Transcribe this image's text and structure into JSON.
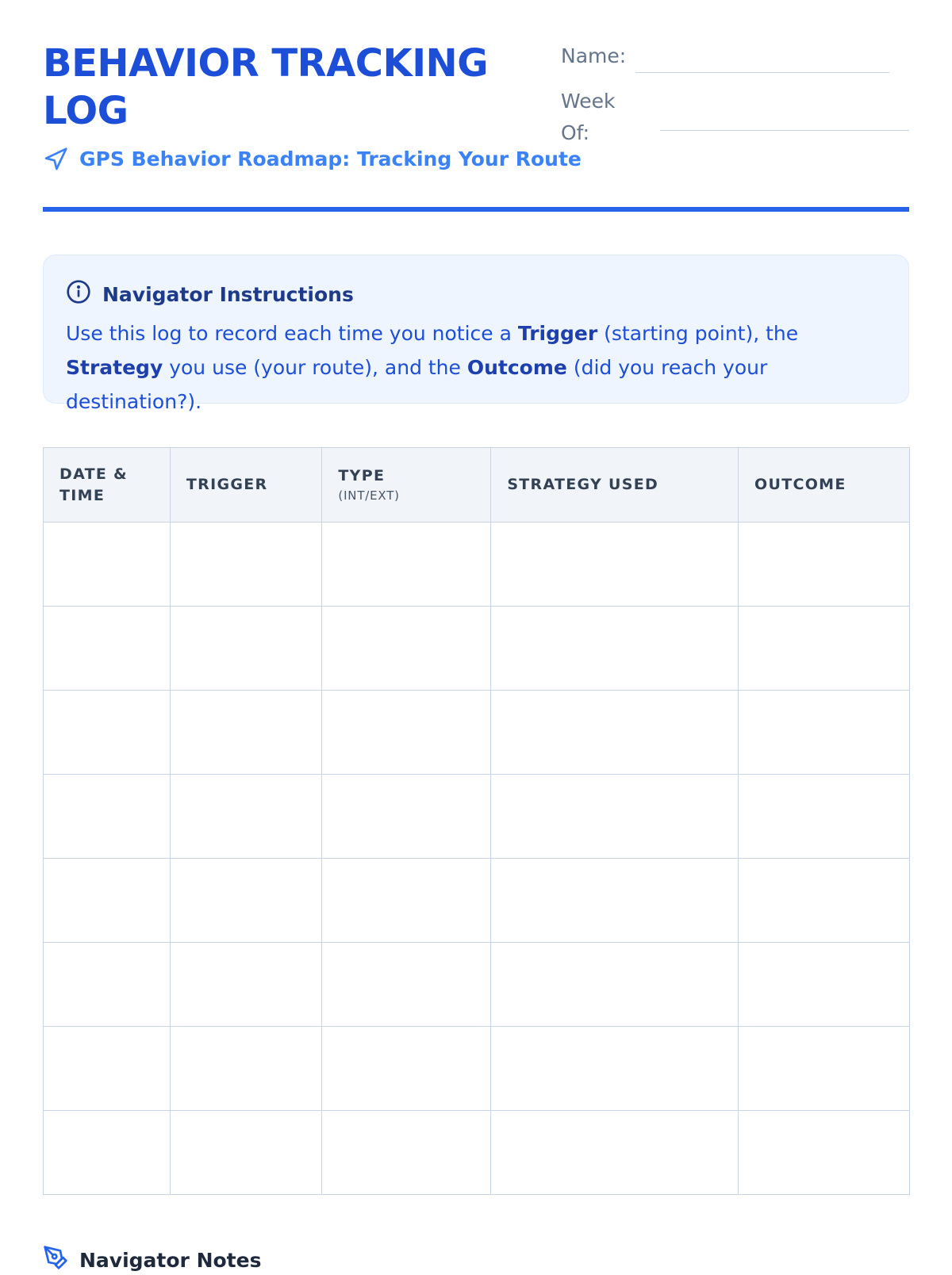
{
  "header": {
    "title": "BEHAVIOR TRACKING LOG",
    "subtitle": "GPS Behavior Roadmap: Tracking Your Route",
    "subtitle_icon": "navigation-arrow-icon"
  },
  "fields": {
    "name_label": "Name:",
    "week_label": "Week Of:"
  },
  "instructions": {
    "icon": "info-icon",
    "heading": "Navigator Instructions",
    "text_1": "Use this log to record each time you notice a ",
    "trigger": "Trigger",
    "text_2": " (starting point), the ",
    "strategy": "Strategy",
    "text_3": " you use (your route), and the ",
    "outcome": "Outcome",
    "text_4": " (did you reach your destination?)."
  },
  "table": {
    "columns": [
      {
        "label": "DATE & TIME",
        "sub": ""
      },
      {
        "label": "TRIGGER",
        "sub": ""
      },
      {
        "label": "TYPE",
        "sub": "(INT/EXT)"
      },
      {
        "label": "STRATEGY USED",
        "sub": ""
      },
      {
        "label": "OUTCOME",
        "sub": ""
      }
    ],
    "rows": [
      [
        "",
        "",
        "",
        "",
        ""
      ],
      [
        "",
        "",
        "",
        "",
        ""
      ],
      [
        "",
        "",
        "",
        "",
        ""
      ],
      [
        "",
        "",
        "",
        "",
        ""
      ],
      [
        "",
        "",
        "",
        "",
        ""
      ],
      [
        "",
        "",
        "",
        "",
        ""
      ],
      [
        "",
        "",
        "",
        "",
        ""
      ],
      [
        "",
        "",
        "",
        "",
        ""
      ]
    ]
  },
  "notes": {
    "icon": "pen-icon",
    "heading": "Navigator Notes"
  },
  "colors": {
    "accent": "#2563eb",
    "title": "#1d4ed8",
    "subtitle": "#3b82f6",
    "panel_bg": "#eef5ff",
    "border": "#cbd5e1"
  }
}
